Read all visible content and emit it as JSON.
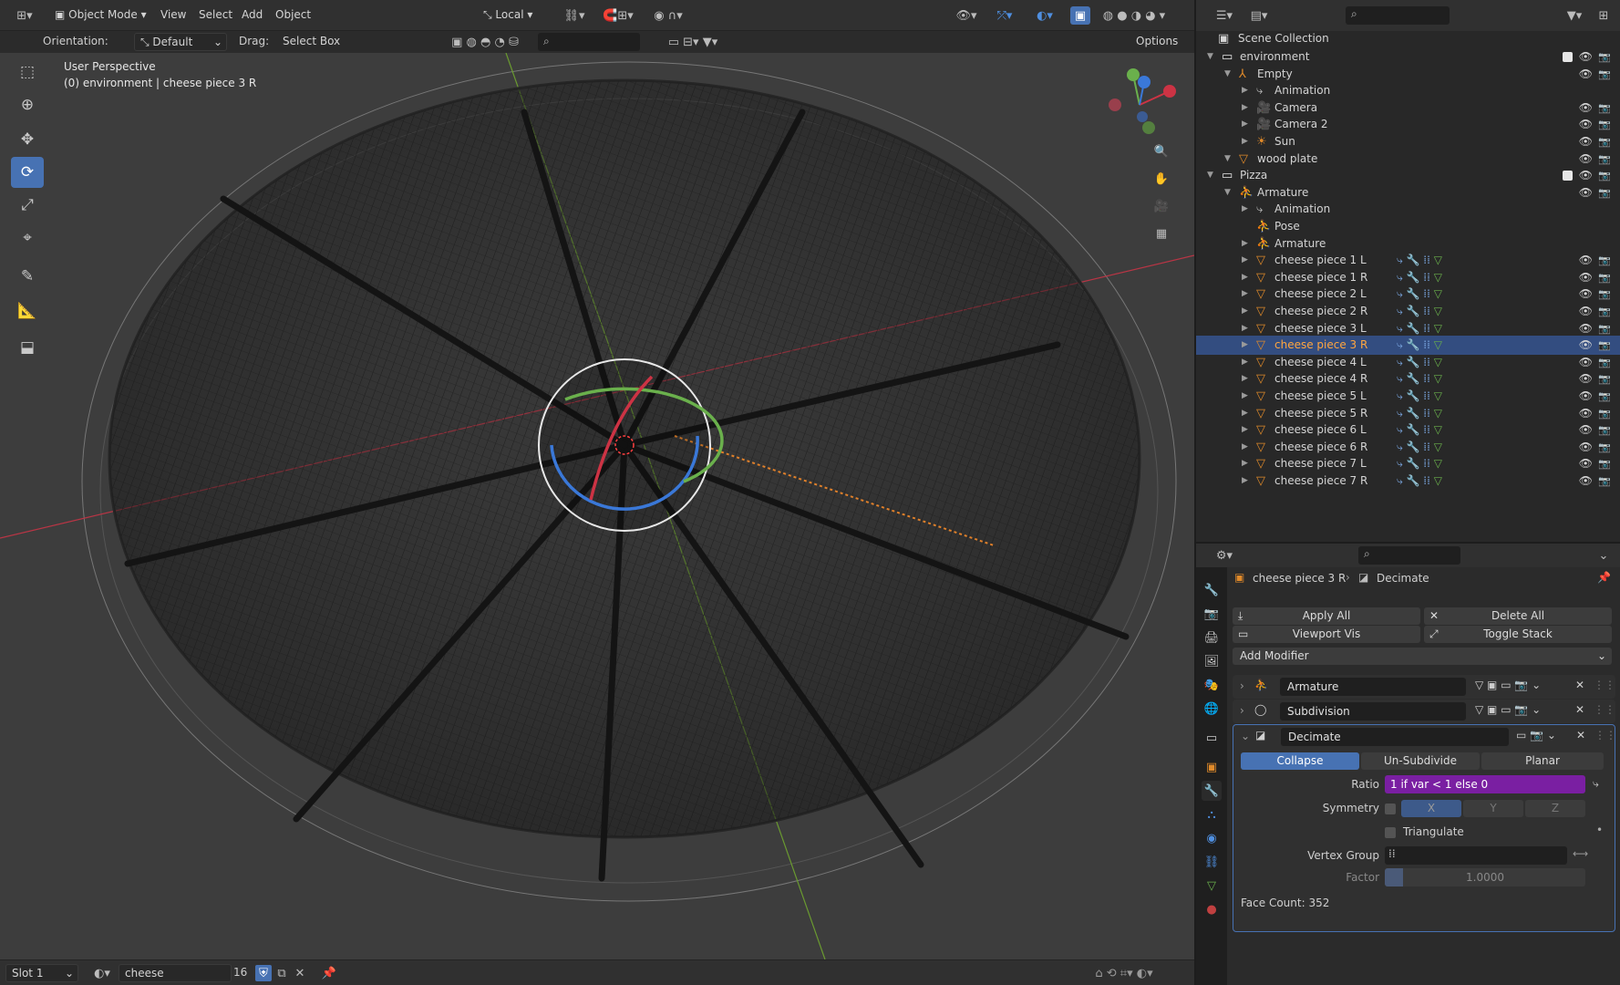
{
  "header": {
    "mode": "Object Mode",
    "menus": [
      "View",
      "Select",
      "Add",
      "Object"
    ],
    "transform_orientation": "Local",
    "orientation_label": "Orientation:",
    "orientation_value": "Default",
    "drag_label": "Drag:",
    "drag_value": "Select Box",
    "options_label": "Options"
  },
  "viewport": {
    "perspective": "User Perspective",
    "context": "(0) environment | cheese piece 3 R"
  },
  "outliner": {
    "title": "Scene Collection",
    "rows": [
      {
        "label": "environment",
        "indent": 0,
        "icon": "collection-icon"
      },
      {
        "label": "Empty",
        "indent": 1,
        "icon": "empty-icon"
      },
      {
        "label": "Animation",
        "indent": 2,
        "icon": "action-icon"
      },
      {
        "label": "Camera",
        "indent": 2,
        "icon": "camera-icon"
      },
      {
        "label": "Camera 2",
        "indent": 2,
        "icon": "camera-icon"
      },
      {
        "label": "Sun",
        "indent": 2,
        "icon": "light-icon"
      },
      {
        "label": "wood plate",
        "indent": 1,
        "icon": "mesh-icon"
      },
      {
        "label": "Pizza",
        "indent": 0,
        "icon": "collection-icon"
      },
      {
        "label": "Armature",
        "indent": 1,
        "icon": "armature-icon"
      },
      {
        "label": "Animation",
        "indent": 2,
        "icon": "action-icon"
      },
      {
        "label": "Pose",
        "indent": 2,
        "icon": "pose-icon"
      },
      {
        "label": "Armature",
        "indent": 2,
        "icon": "armature-data-icon"
      },
      {
        "label": "cheese piece 1 L",
        "indent": 2,
        "icon": "mesh-icon"
      },
      {
        "label": "cheese piece 1 R",
        "indent": 2,
        "icon": "mesh-icon"
      },
      {
        "label": "cheese piece 2 L",
        "indent": 2,
        "icon": "mesh-icon"
      },
      {
        "label": "cheese piece 2 R",
        "indent": 2,
        "icon": "mesh-icon"
      },
      {
        "label": "cheese piece 3 L",
        "indent": 2,
        "icon": "mesh-icon"
      },
      {
        "label": "cheese piece 3 R",
        "indent": 2,
        "icon": "mesh-icon",
        "selected": true
      },
      {
        "label": "cheese piece 4 L",
        "indent": 2,
        "icon": "mesh-icon"
      },
      {
        "label": "cheese piece 4 R",
        "indent": 2,
        "icon": "mesh-icon"
      },
      {
        "label": "cheese piece 5 L",
        "indent": 2,
        "icon": "mesh-icon"
      },
      {
        "label": "cheese piece 5 R",
        "indent": 2,
        "icon": "mesh-icon"
      },
      {
        "label": "cheese piece 6 L",
        "indent": 2,
        "icon": "mesh-icon"
      },
      {
        "label": "cheese piece 6 R",
        "indent": 2,
        "icon": "mesh-icon"
      },
      {
        "label": "cheese piece 7 L",
        "indent": 2,
        "icon": "mesh-icon"
      },
      {
        "label": "cheese piece 7 R",
        "indent": 2,
        "icon": "mesh-icon"
      }
    ]
  },
  "properties": {
    "breadcrumb_object": "cheese piece 3 R",
    "breadcrumb_modifier": "Decimate",
    "apply_all": "Apply All",
    "delete_all": "Delete All",
    "viewport_vis": "Viewport Vis",
    "toggle_stack": "Toggle Stack",
    "add_modifier": "Add Modifier",
    "modifiers": [
      "Armature",
      "Subdivision",
      "Decimate"
    ],
    "decimate": {
      "modes": [
        "Collapse",
        "Un-Subdivide",
        "Planar"
      ],
      "active_mode": "Collapse",
      "ratio_label": "Ratio",
      "ratio_value": "1 if var < 1 else 0",
      "symmetry_label": "Symmetry",
      "axes": [
        "X",
        "Y",
        "Z"
      ],
      "triangulate_label": "Triangulate",
      "vertex_group_label": "Vertex Group",
      "factor_label": "Factor",
      "factor_value": "1.0000",
      "face_count": "Face Count: 352"
    }
  },
  "statusbar": {
    "slot": "Slot 1",
    "material": "cheese",
    "users": "16"
  },
  "colors": {
    "accent": "#4772b3",
    "selected_row": "#334d80",
    "driver_field": "#7a1fa2",
    "axis_x": "#cc3344",
    "axis_y": "#6ab04c",
    "axis_z": "#3a78d8"
  }
}
